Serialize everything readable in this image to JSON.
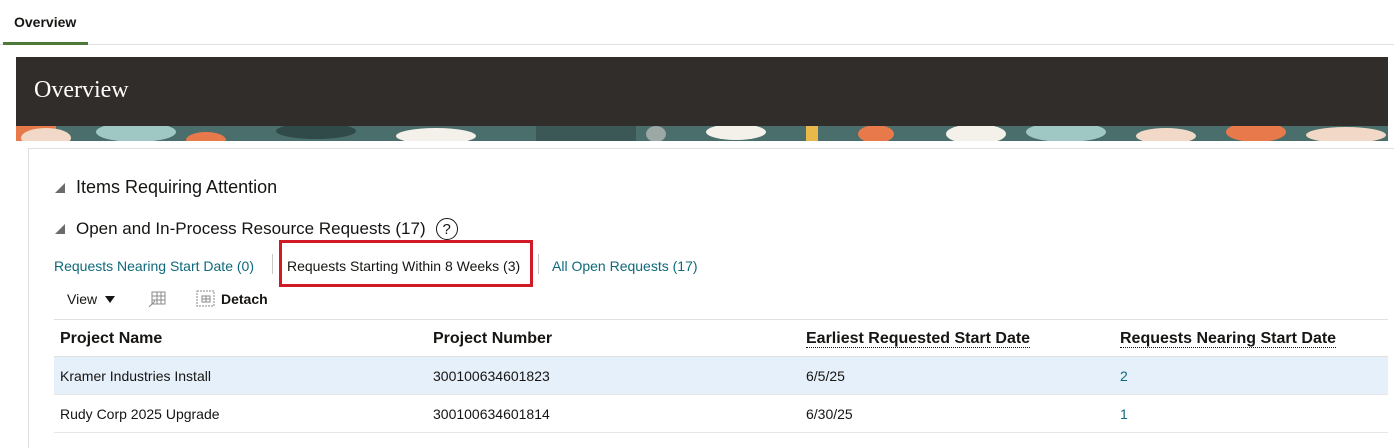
{
  "tabs": [
    {
      "label": "Overview"
    }
  ],
  "banner": {
    "title": "Overview"
  },
  "sections": {
    "attention": "Items Requiring Attention",
    "requests": "Open and In-Process Resource Requests (17)",
    "help_symbol": "?"
  },
  "filters": [
    {
      "label": "Requests Nearing Start Date (0)"
    },
    {
      "label": "Requests Starting Within 8 Weeks (3)"
    },
    {
      "label": "All Open Requests (17)"
    }
  ],
  "toolbar": {
    "view_label": "View",
    "detach_label": "Detach"
  },
  "table": {
    "columns": [
      "Project Name",
      "Project Number",
      "Earliest Requested Start Date",
      "Requests Nearing Start Date"
    ],
    "rows": [
      {
        "name": "Kramer Industries Install",
        "number": "300100634601823",
        "start": "6/5/25",
        "nearing": "2"
      },
      {
        "name": "Rudy Corp 2025 Upgrade",
        "number": "300100634601814",
        "start": "6/30/25",
        "nearing": "1"
      }
    ]
  },
  "colors": {
    "accent": "#4d7a3a",
    "banner": "#312d2a",
    "link": "#0e6a7a",
    "highlight": "#d01a26"
  }
}
